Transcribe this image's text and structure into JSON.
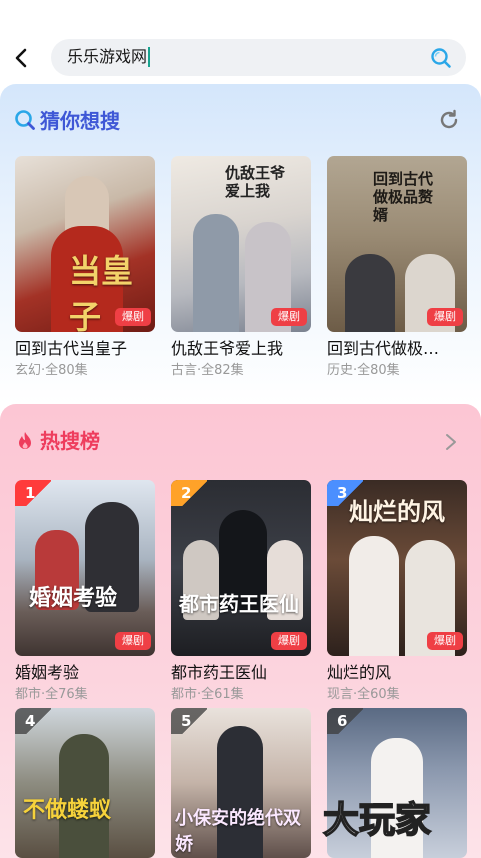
{
  "search": {
    "value": "乐乐游戏网"
  },
  "guess": {
    "title": "猜你想搜",
    "items": [
      {
        "title": "回到古代当皇子",
        "meta": "玄幻·全80集",
        "tag": "爆剧",
        "poster_text": "当皇子"
      },
      {
        "title": "仇敌王爷爱上我",
        "meta": "古言·全82集",
        "tag": "爆剧",
        "poster_text": "仇敌王爷爱上我"
      },
      {
        "title": "回到古代做极…",
        "meta": "历史·全80集",
        "tag": "爆剧",
        "poster_text": "回到古代做极品赘婿"
      }
    ]
  },
  "hot": {
    "title": "热搜榜",
    "items": [
      {
        "rank": "1",
        "title": "婚姻考验",
        "meta": "都市·全76集",
        "tag": "爆剧",
        "poster_text": "婚姻考验"
      },
      {
        "rank": "2",
        "title": "都市药王医仙",
        "meta": "都市·全61集",
        "tag": "爆剧",
        "poster_text": "都市药王医仙"
      },
      {
        "rank": "3",
        "title": "灿烂的风",
        "meta": "现言·全60集",
        "tag": "爆剧",
        "poster_text": "灿烂的风"
      },
      {
        "rank": "4",
        "poster_text": "不做蝼蚁"
      },
      {
        "rank": "5",
        "poster_text": "小保安的绝代双娇"
      },
      {
        "rank": "6"
      }
    ]
  },
  "watermark": "大玩家",
  "colors": {
    "accent_blue": "#3f58d6",
    "accent_red": "#ee3d5d",
    "tag_red": "#ef3f45",
    "caret": "#1aa38f"
  }
}
